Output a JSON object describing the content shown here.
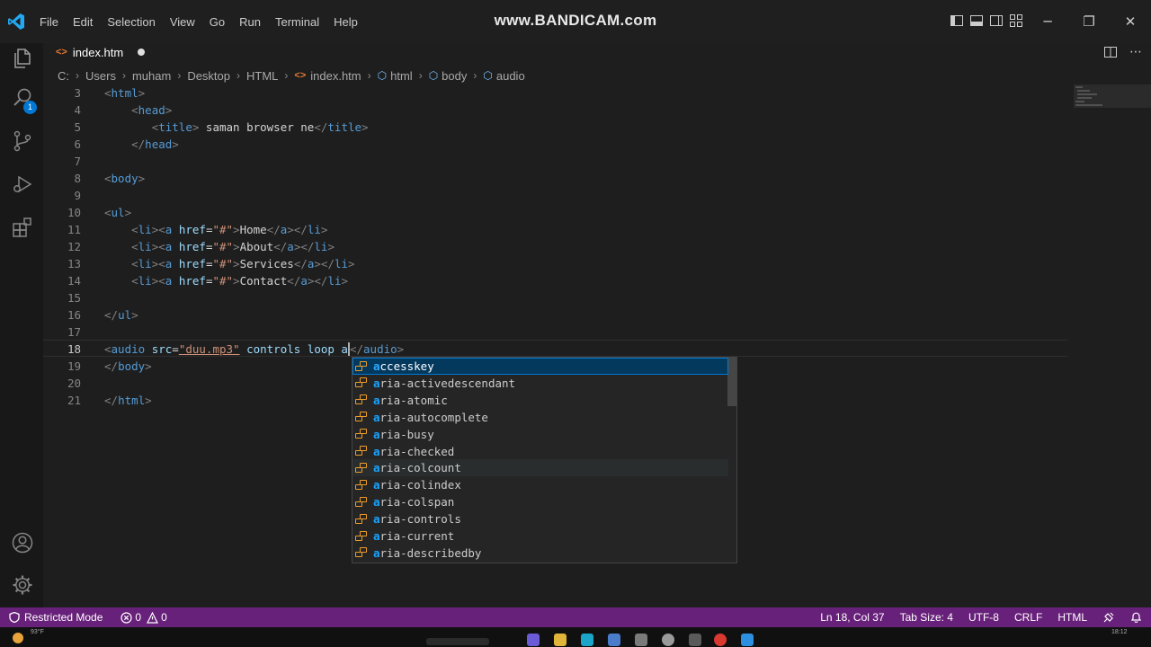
{
  "titlebar": {
    "menu": [
      "File",
      "Edit",
      "Selection",
      "View",
      "Go",
      "Run",
      "Terminal",
      "Help"
    ],
    "watermark": "www.BANDICAM.com"
  },
  "activitybar": {
    "explorer_badge": "1"
  },
  "tab": {
    "filename": "index.htm"
  },
  "breadcrumb": {
    "parts": [
      "C:",
      "Users",
      "muham",
      "Desktop",
      "HTML"
    ],
    "file": "index.htm",
    "elements": [
      "html",
      "body",
      "audio"
    ]
  },
  "editor": {
    "lines": [
      {
        "n": "3"
      },
      {
        "n": "4"
      },
      {
        "n": "5"
      },
      {
        "n": "6"
      },
      {
        "n": "7"
      },
      {
        "n": "8"
      },
      {
        "n": "9"
      },
      {
        "n": "10"
      },
      {
        "n": "11"
      },
      {
        "n": "12"
      },
      {
        "n": "13"
      },
      {
        "n": "14"
      },
      {
        "n": "15"
      },
      {
        "n": "16"
      },
      {
        "n": "17"
      },
      {
        "n": "18"
      },
      {
        "n": "19"
      },
      {
        "n": "20"
      },
      {
        "n": "21"
      }
    ],
    "title_text": " saman browser ne",
    "nav": [
      "Home",
      "About",
      "Services",
      "Contact"
    ],
    "audio_src": "\"duu.mp3\"",
    "audio_attrs": " controls loop a"
  },
  "suggest": {
    "typed": "a",
    "items": [
      "accesskey",
      "aria-activedescendant",
      "aria-atomic",
      "aria-autocomplete",
      "aria-busy",
      "aria-checked",
      "aria-colcount",
      "aria-colindex",
      "aria-colspan",
      "aria-controls",
      "aria-current",
      "aria-describedby"
    ],
    "selected_index": 0,
    "hover_index": 6
  },
  "statusbar": {
    "restricted": "Restricted Mode",
    "errors": "0",
    "warnings": "0",
    "position": "Ln 18, Col 37",
    "tab_size": "Tab Size: 4",
    "encoding": "UTF-8",
    "eol": "CRLF",
    "language": "HTML"
  },
  "taskbar": {
    "weather": "93°F",
    "clock": "18:12"
  },
  "colors": {
    "statusbar": "#68217a",
    "tag": "#569cd6",
    "attribute": "#9cdcfe",
    "string": "#ce9178",
    "accent": "#0078d4"
  }
}
